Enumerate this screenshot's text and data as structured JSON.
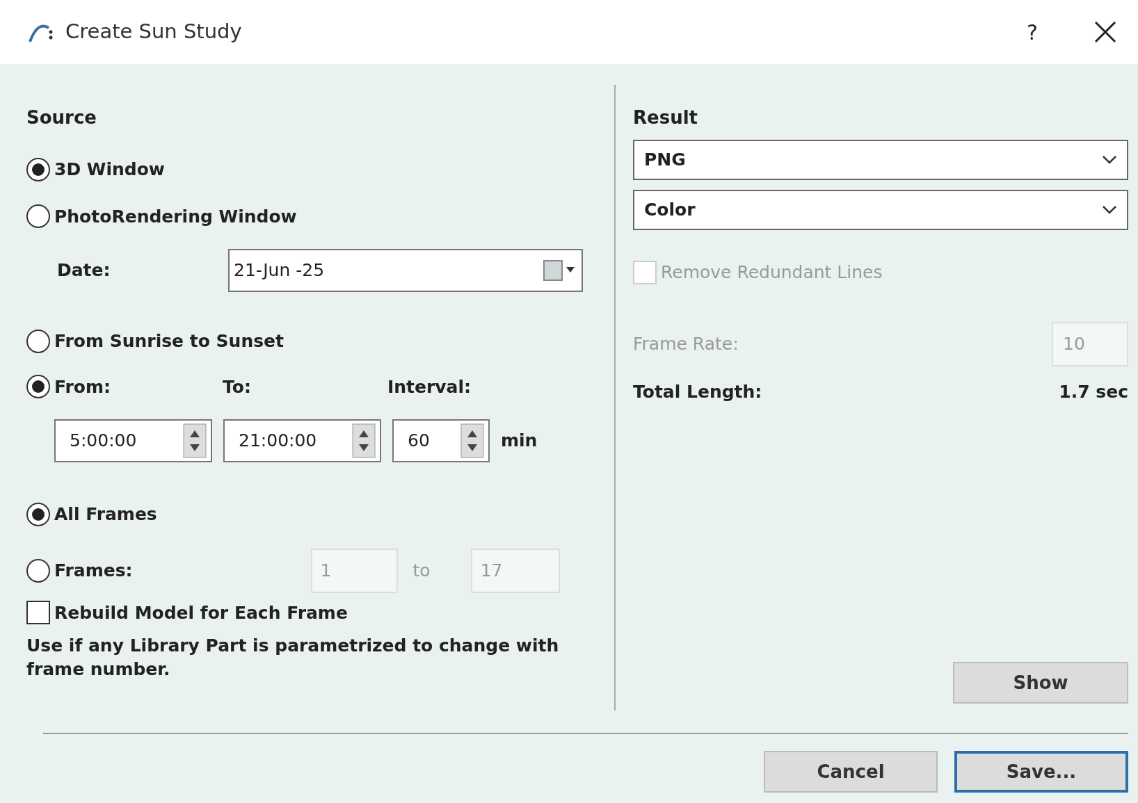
{
  "window": {
    "title": "Create Sun Study",
    "help": "?"
  },
  "source": {
    "heading": "Source",
    "modes": [
      {
        "label": "3D Window",
        "selected": true
      },
      {
        "label": "PhotoRendering Window",
        "selected": false
      }
    ],
    "date": {
      "label": "Date:",
      "value": "21-Jun -25"
    },
    "range": [
      {
        "label": "From Sunrise to Sunset",
        "selected": false
      },
      {
        "label": "From:",
        "selected": true
      }
    ],
    "to_label": "To:",
    "interval_label": "Interval:",
    "from_time": "5:00:00",
    "to_time": "21:00:00",
    "interval": "60",
    "interval_unit": "min",
    "frames": [
      {
        "label": "All Frames",
        "selected": true
      },
      {
        "label": "Frames:",
        "selected": false
      }
    ],
    "frame_range": {
      "from": "1",
      "to_label": "to",
      "to": "17",
      "disabled": true
    },
    "rebuild": {
      "label": "Rebuild Model for Each Frame",
      "checked": false
    },
    "note": "Use if any Library Part is parametrized to change with frame number."
  },
  "result": {
    "heading": "Result",
    "format": "PNG",
    "color_mode": "Color",
    "remove_lines": {
      "label": "Remove Redundant Lines",
      "checked": false,
      "disabled": true
    },
    "frame_rate": {
      "label": "Frame Rate:",
      "value": "10",
      "disabled": true
    },
    "total_length": {
      "label": "Total Length:",
      "value": "1.7 sec"
    },
    "show_button": "Show"
  },
  "buttons": [
    {
      "label": "Cancel",
      "default": false
    },
    {
      "label": "Save...",
      "default": true
    }
  ]
}
